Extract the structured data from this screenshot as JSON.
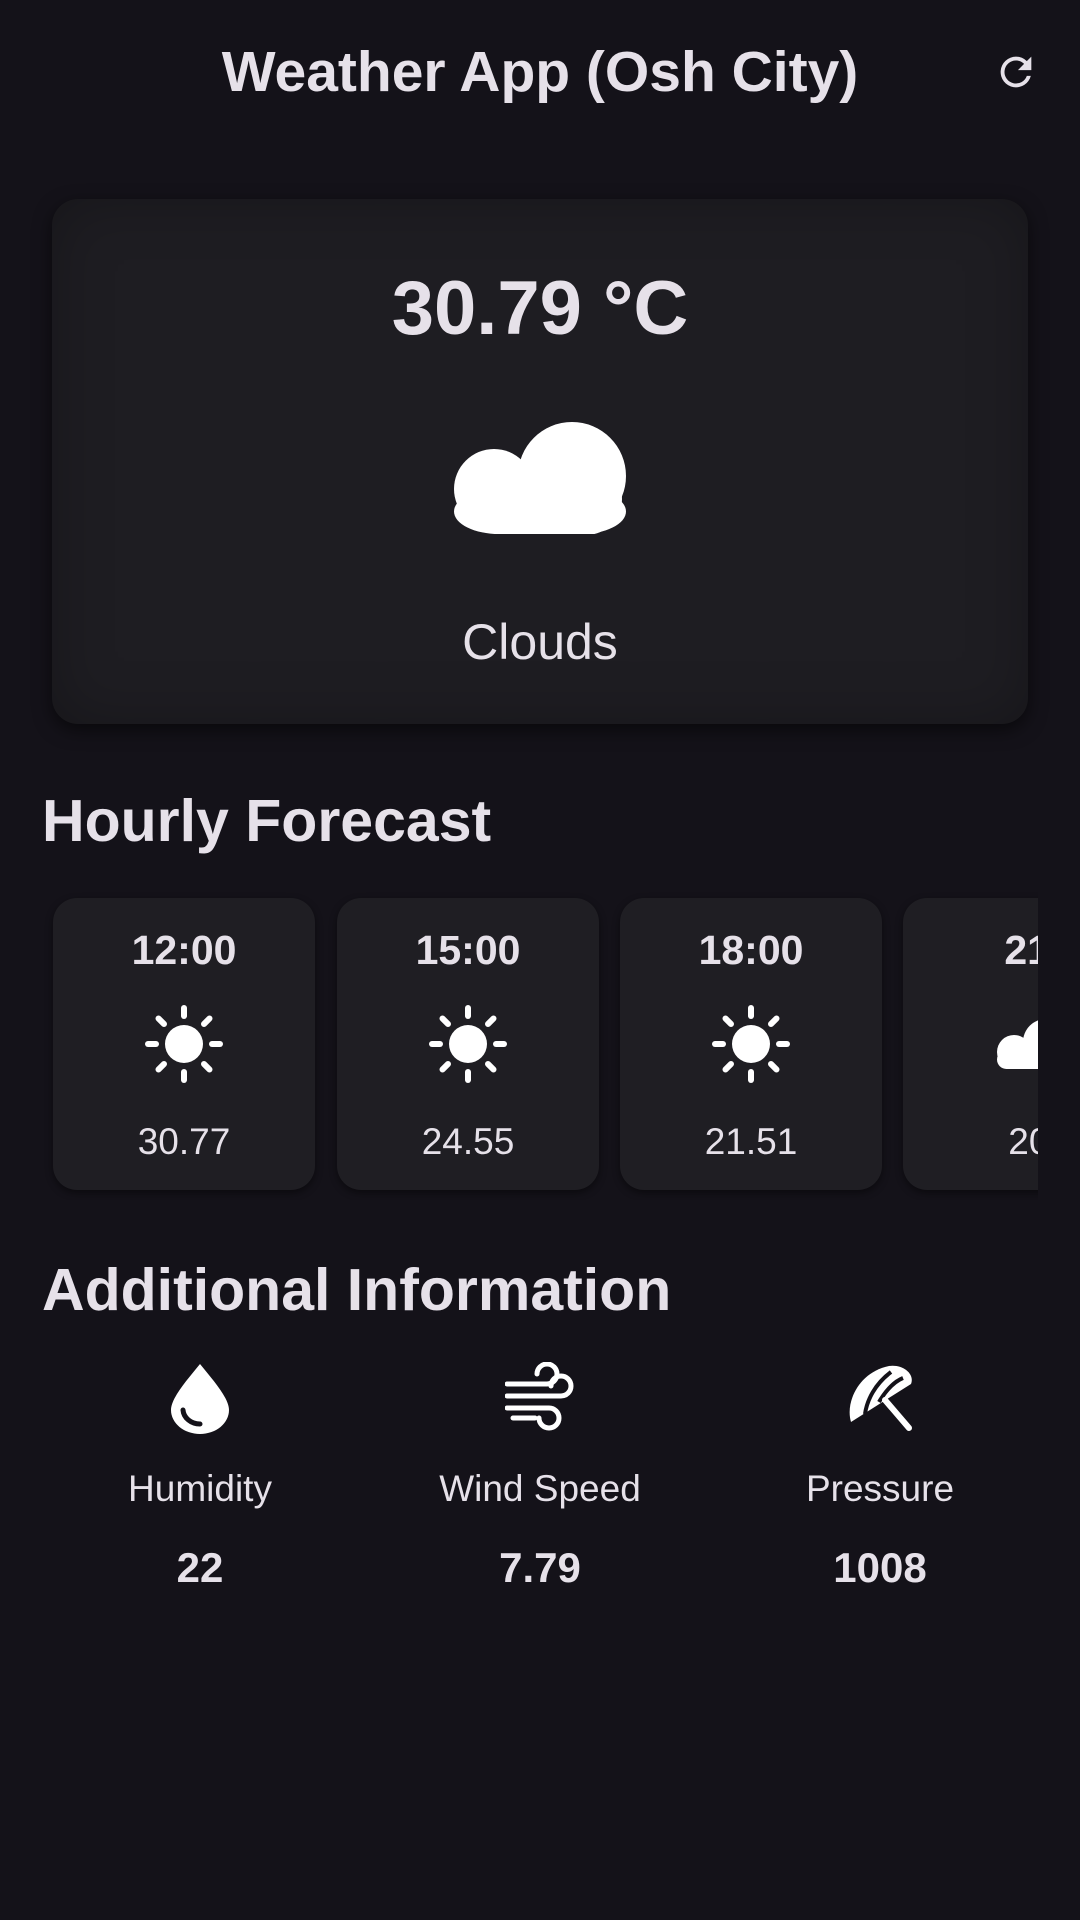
{
  "app_bar": {
    "title": "Weather App (Osh City)",
    "refresh_icon": "refresh-icon"
  },
  "current": {
    "temperature": "30.79 °C",
    "condition": "Clouds",
    "icon": "cloud-icon"
  },
  "hourly": {
    "title": "Hourly Forecast",
    "items": [
      {
        "time": "12:00",
        "icon": "sun-icon",
        "temp": "30.77"
      },
      {
        "time": "15:00",
        "icon": "sun-icon",
        "temp": "24.55"
      },
      {
        "time": "18:00",
        "icon": "sun-icon",
        "temp": "21.51"
      },
      {
        "time": "21:",
        "icon": "cloud-icon",
        "temp": "20."
      }
    ]
  },
  "additional": {
    "title": "Additional Information",
    "items": [
      {
        "label": "Humidity",
        "value": "22",
        "icon": "water-drop-icon"
      },
      {
        "label": "Wind Speed",
        "value": "7.79",
        "icon": "wind-icon"
      },
      {
        "label": "Pressure",
        "value": "1008",
        "icon": "beach-umbrella-icon"
      }
    ]
  },
  "colors": {
    "background": "#141219",
    "card": "#1e1d22",
    "text": "#e6e1e9"
  }
}
